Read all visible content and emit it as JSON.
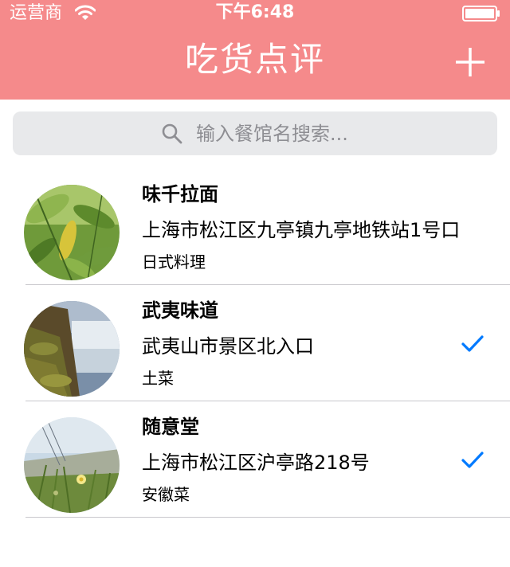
{
  "status_bar": {
    "carrier": "运营商",
    "time": "下午6:48",
    "wifi_icon": "wifi-icon",
    "battery_icon": "battery-icon"
  },
  "nav": {
    "title": "吃货点评",
    "add_icon": "plus-icon",
    "background_color": "#f58a8b"
  },
  "search": {
    "placeholder": "输入餐馆名搜索...",
    "icon": "search-icon"
  },
  "restaurants": [
    {
      "name": "味千拉面",
      "address": "上海市松江区九亭镇九亭地铁站1号口",
      "cuisine": "日式料理",
      "checked": false,
      "thumbnail": "leaves-photo"
    },
    {
      "name": "武夷味道",
      "address": "武夷山市景区北入口",
      "cuisine": "土菜",
      "checked": true,
      "thumbnail": "waterfall-photo"
    },
    {
      "name": "随意堂",
      "address": "上海市松江区沪亭路218号",
      "cuisine": "安徽菜",
      "checked": true,
      "thumbnail": "flower-field-photo"
    }
  ],
  "colors": {
    "accent": "#007aff",
    "separator": "#c8c7cc"
  }
}
